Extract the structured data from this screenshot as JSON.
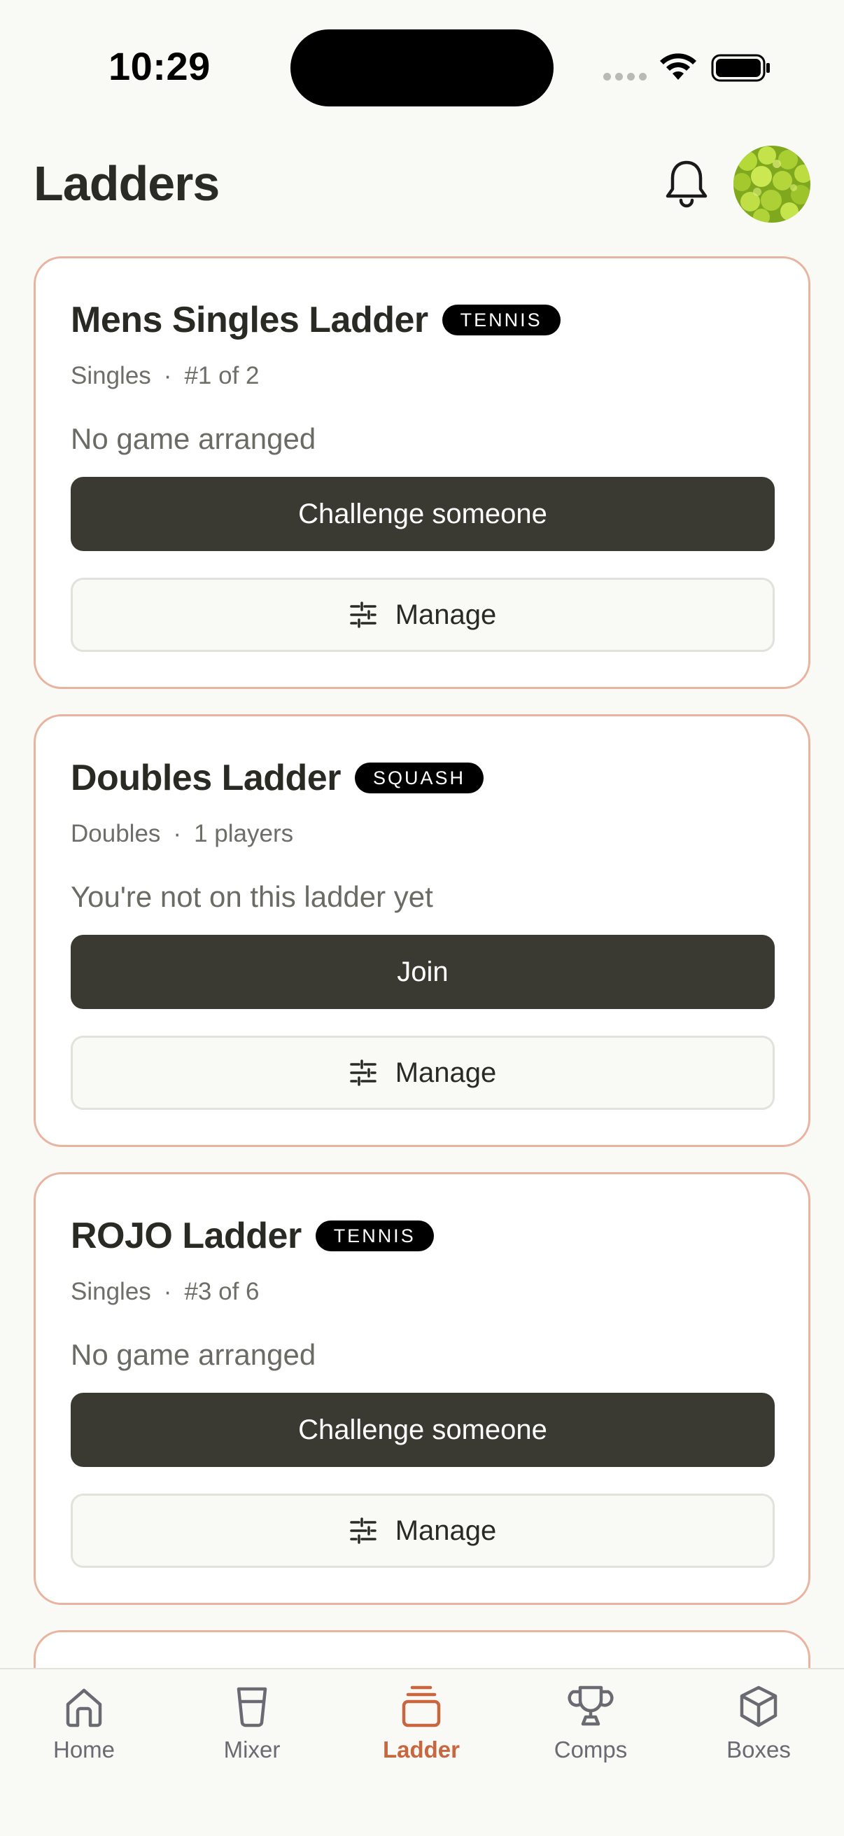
{
  "status_bar": {
    "time": "10:29"
  },
  "header": {
    "title": "Ladders"
  },
  "cards": [
    {
      "title": "Mens Singles Ladder",
      "sport": "TENNIS",
      "format": "Singles",
      "detail": "#1 of 2",
      "status": "No game arranged",
      "primary_label": "Challenge someone",
      "manage_label": "Manage"
    },
    {
      "title": "Doubles Ladder",
      "sport": "SQUASH",
      "format": "Doubles",
      "detail": "1 players",
      "status": "You're not on this ladder yet",
      "primary_label": "Join",
      "manage_label": "Manage"
    },
    {
      "title": "ROJO Ladder",
      "sport": "TENNIS",
      "format": "Singles",
      "detail": "#3 of 6",
      "status": "No game arranged",
      "primary_label": "Challenge someone",
      "manage_label": "Manage"
    }
  ],
  "tabs": [
    {
      "label": "Home",
      "icon": "home-icon"
    },
    {
      "label": "Mixer",
      "icon": "cup-icon"
    },
    {
      "label": "Ladder",
      "icon": "ladder-stack-icon",
      "active": true
    },
    {
      "label": "Comps",
      "icon": "trophy-icon"
    },
    {
      "label": "Boxes",
      "icon": "box-icon"
    }
  ],
  "colors": {
    "background": "#f9f9f5",
    "card_border": "#e8b49f",
    "primary_button": "#3a3a33",
    "accent": "#c8673f",
    "badge": "#000000"
  }
}
